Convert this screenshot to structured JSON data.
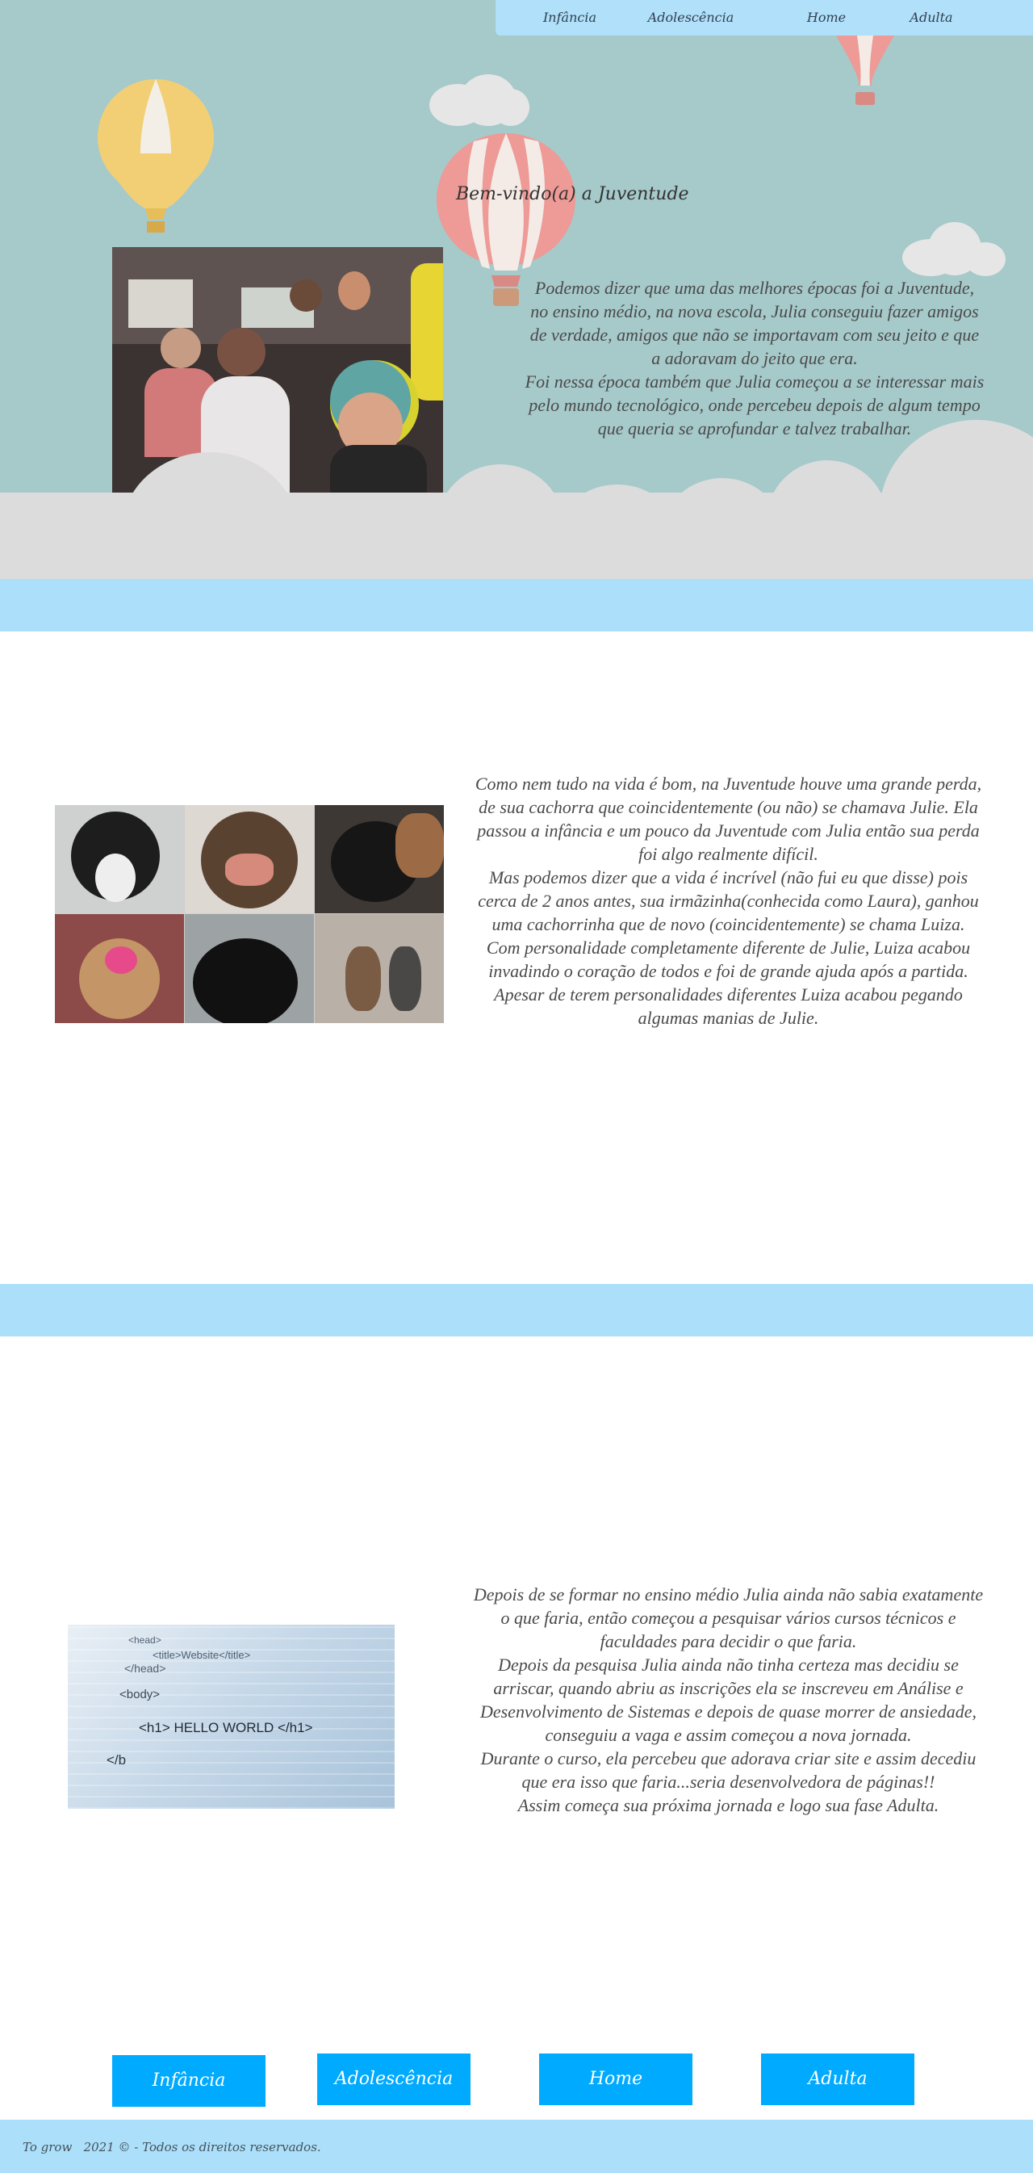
{
  "nav": {
    "items": [
      {
        "label": "Infância"
      },
      {
        "label": "Adolescência"
      },
      {
        "label": "Home"
      },
      {
        "label": "Adulta"
      }
    ]
  },
  "hero": {
    "title": "Bem-vindo(a) a Juventude",
    "paragraphs": [
      "Podemos dizer que uma das melhores épocas foi a Juventude, no ensino médio, na nova escola, Julia conseguiu fazer amigos de verdade, amigos que não se importavam com seu jeito e que a adoravam do jeito que era.",
      "Foi nessa época também que Julia começou a se interessar mais pelo mundo tecnológico, onde percebeu depois de algum tempo que queria se aprofundar e talvez trabalhar."
    ]
  },
  "section2": {
    "paragraphs": [
      "Como nem tudo na vida é bom, na Juventude houve uma grande perda, de sua cachorra que coincidentemente (ou não) se chamava Julie. Ela passou a infância e um pouco da Juventude com Julia então sua perda foi algo realmente difícil.",
      "Mas podemos dizer que a vida é incrível (não fui eu que disse) pois cerca de 2 anos antes, sua irmãzinha(conhecida como Laura), ganhou uma cachorrinha que de novo (coincidentemente) se chama Luiza.",
      "Com personalidade completamente diferente de Julie, Luiza acabou invadindo o coração de todos e foi de grande ajuda após a partida. Apesar de terem personalidades diferentes Luiza acabou pegando algumas manias de Julie."
    ]
  },
  "section3": {
    "code_image": {
      "line1": "<head>",
      "line2": "<title>Website</title>",
      "line3": "</head>",
      "line4": "<body>",
      "line5": "<h1> HELLO WORLD </h1>",
      "line6": "</b"
    },
    "paragraphs": [
      "Depois de se formar no ensino médio Julia ainda não sabia exatamente o que faria, então começou a pesquisar vários cursos técnicos e faculdades para decidir o que faria.",
      "Depois da pesquisa Julia ainda não tinha certeza mas decidiu se arriscar, quando abriu as inscrições ela se inscreveu em Análise e Desenvolvimento de Sistemas e depois de quase morrer de ansiedade, conseguiu a vaga e assim começou a nova jornada.",
      "Durante o curso, ela percebeu que adorava criar site e assim decediu que era isso que faria...seria desenvolvedora de páginas!!",
      "Assim começa sua próxima jornada e logo sua fase Adulta."
    ]
  },
  "bottom_nav": {
    "buttons": [
      {
        "label": "Infância"
      },
      {
        "label": "Adolescência"
      },
      {
        "label": "Home"
      },
      {
        "label": "Adulta"
      }
    ]
  },
  "footer": {
    "text": "To grow   2021 © - Todos os direitos reservados."
  },
  "colors": {
    "hero_background": "#a6c9ca",
    "band": "#abdffa",
    "button": "#00aaff",
    "balloon_yellow": "#f2cf74",
    "balloon_pink": "#ee9a96"
  }
}
